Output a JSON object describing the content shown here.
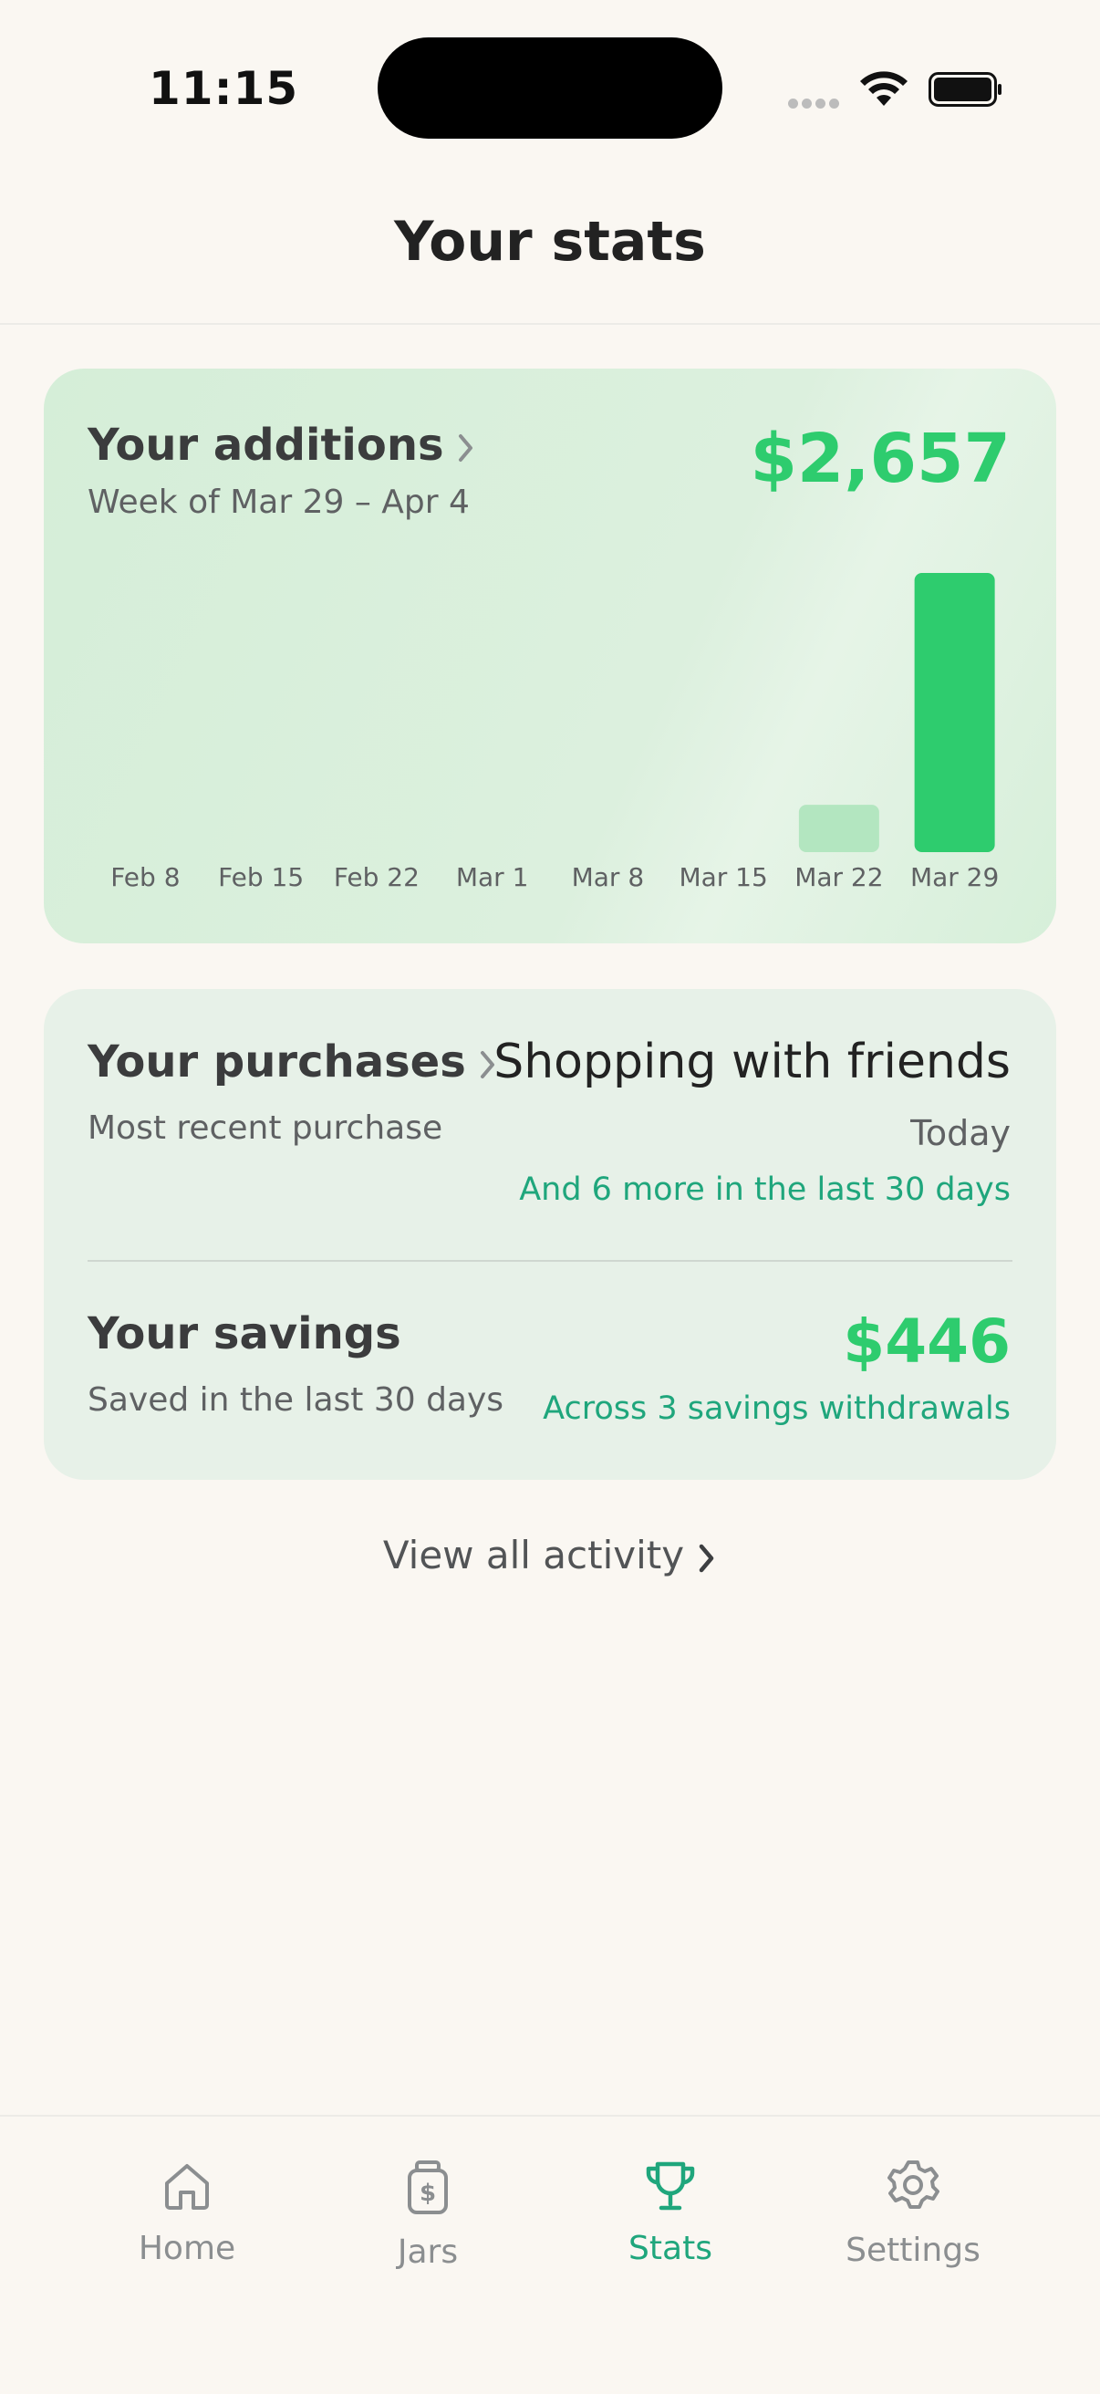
{
  "status": {
    "time": "11:15"
  },
  "header": {
    "title": "Your stats"
  },
  "additions": {
    "title": "Your additions",
    "subtitle": "Week of Mar 29 – Apr 4",
    "amount": "$2,657"
  },
  "chart_data": {
    "type": "bar",
    "categories": [
      "Feb 8",
      "Feb 15",
      "Feb 22",
      "Mar 1",
      "Mar 8",
      "Mar 15",
      "Mar 22",
      "Mar 29"
    ],
    "values": [
      0,
      0,
      0,
      0,
      0,
      0,
      450,
      2657
    ],
    "ylim": [
      0,
      2657
    ],
    "grid": false,
    "colors": {
      "current": "#2ecc6e",
      "past": "#b3e6c0"
    }
  },
  "purchases": {
    "title": "Your purchases",
    "subtitle": "Most recent purchase",
    "latest_name": "Shopping with friends",
    "latest_when": "Today",
    "more": "And 6 more in the last 30 days"
  },
  "savings": {
    "title": "Your savings",
    "subtitle": "Saved in the last 30 days",
    "amount": "$446",
    "note": "Across 3 savings withdrawals"
  },
  "view_all": {
    "label": "View all activity"
  },
  "tabbar": {
    "tabs": [
      {
        "label": "Home",
        "icon": "home-icon"
      },
      {
        "label": "Jars",
        "icon": "jar-icon"
      },
      {
        "label": "Stats",
        "icon": "trophy-icon",
        "active": true
      },
      {
        "label": "Settings",
        "icon": "gear-icon"
      }
    ],
    "active_color": "#1fa67c"
  }
}
